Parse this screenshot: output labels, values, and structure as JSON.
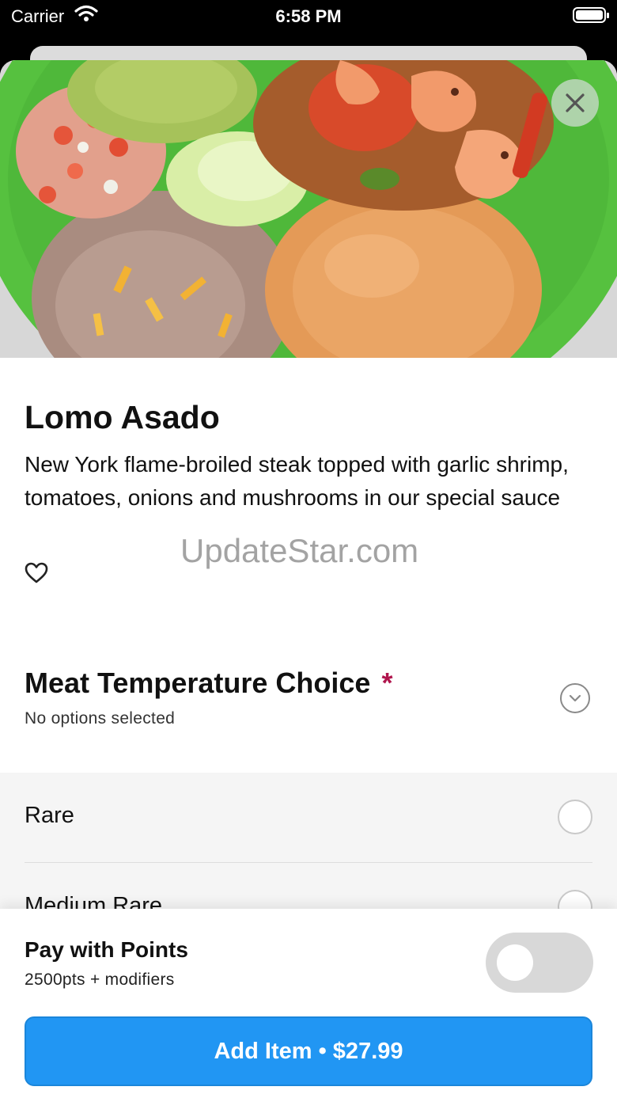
{
  "status_bar": {
    "carrier": "Carrier",
    "time": "6:58 PM"
  },
  "item": {
    "title": "Lomo Asado",
    "description": "New York flame-broiled steak topped with garlic shrimp, tomatoes, onions and mushrooms in our special sauce",
    "watermark": "UpdateStar.com"
  },
  "modifier": {
    "title": "Meat Temperature Choice",
    "required_mark": "*",
    "subtitle": "No options selected",
    "options": [
      {
        "label": "Rare",
        "selected": false
      },
      {
        "label": "Medium Rare",
        "selected": false
      }
    ]
  },
  "points": {
    "title": "Pay with Points",
    "subtitle": "2500pts + modifiers",
    "enabled": false
  },
  "add_button": {
    "label": "Add Item • $27.99"
  },
  "colors": {
    "accent": "#2196f3",
    "required": "#b0154d",
    "plate": "#56c13f"
  },
  "icons": [
    "wifi-icon",
    "battery-icon",
    "close-icon",
    "heart-icon",
    "chevron-down-icon"
  ]
}
